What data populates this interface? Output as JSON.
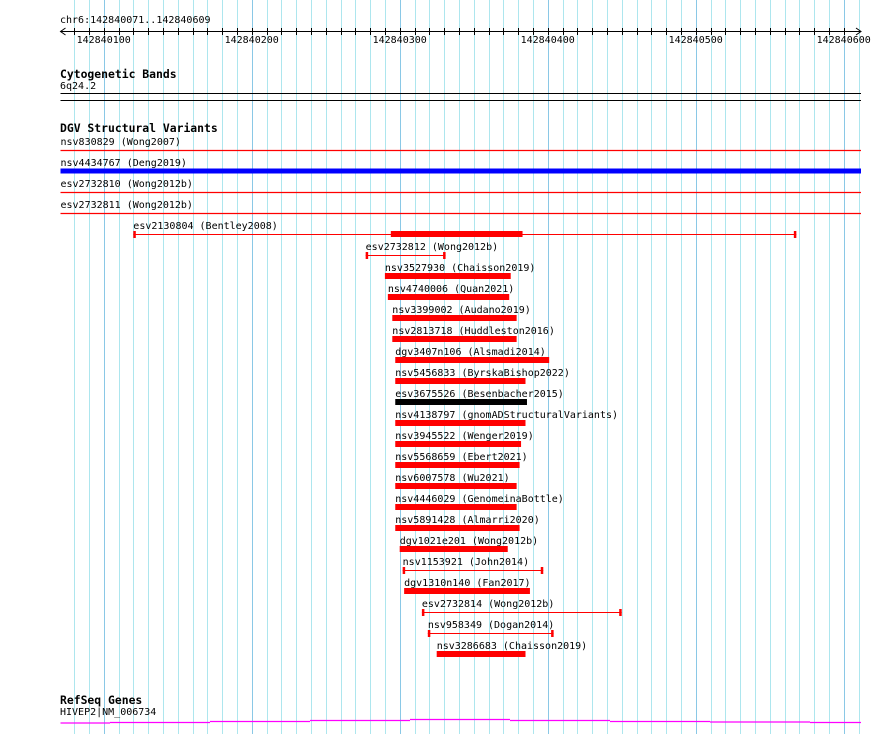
{
  "view": {
    "chrom": "chr6",
    "start": 142840071,
    "end": 142840609,
    "location_label": "chr6:142840071..142840609",
    "ruler_ticks": [
      "142840100",
      "142840200",
      "142840300",
      "142840400",
      "142840500",
      "142840600"
    ],
    "grid_major_bp": 100,
    "grid_minor_bp": 10
  },
  "colors": {
    "grid_minor": "#ade6ee",
    "grid_major": "#8ac8e6",
    "loss": "#ff0000",
    "gain": "#0000ff",
    "complex": "#000000",
    "gene": "#ff00ff"
  },
  "tracks": {
    "cytoband": {
      "title": "Cytogenetic Bands",
      "label": "6q24.2"
    },
    "dgv": {
      "title": "DGV Structural Variants",
      "features": [
        {
          "label": "nsv830829 (Wong2007)",
          "start": 142840000,
          "end": 142840700,
          "glyph": "line",
          "color": "#ff0000"
        },
        {
          "label": "nsv4434767 (Deng2019)",
          "start": 142840000,
          "end": 142840700,
          "glyph": "thickline",
          "color": "#0000ff"
        },
        {
          "label": "esv2732810 (Wong2012b)",
          "start": 142840000,
          "end": 142840700,
          "glyph": "line",
          "color": "#ff0000"
        },
        {
          "label": "esv2732811 (Wong2012b)",
          "start": 142840000,
          "end": 142840700,
          "glyph": "line",
          "color": "#ff0000"
        },
        {
          "label": "esv2130804 (Bentley2008)",
          "start": 142840120,
          "end": 142840568,
          "thick_start": 142840294,
          "thick_end": 142840383,
          "glyph": "capped",
          "color": "#ff0000"
        },
        {
          "label": "esv2732812 (Wong2012b)",
          "start": 142840277,
          "end": 142840331,
          "glyph": "capped",
          "color": "#ff0000"
        },
        {
          "label": "nsv3527930 (Chaisson2019)",
          "start": 142840290,
          "end": 142840375,
          "glyph": "bar",
          "color": "#ff0000"
        },
        {
          "label": "nsv4740006 (Quan2021)",
          "start": 142840292,
          "end": 142840374,
          "glyph": "bar",
          "color": "#ff0000"
        },
        {
          "label": "nsv3399002 (Audano2019)",
          "start": 142840295,
          "end": 142840379,
          "glyph": "bar",
          "color": "#ff0000"
        },
        {
          "label": "nsv2813718 (Huddleston2016)",
          "start": 142840295,
          "end": 142840379,
          "glyph": "bar",
          "color": "#ff0000"
        },
        {
          "label": "dgv3407n106 (Alsmadi2014)",
          "start": 142840297,
          "end": 142840401,
          "glyph": "bar",
          "color": "#ff0000"
        },
        {
          "label": "nsv5456833 (ByrskaBishop2022)",
          "start": 142840297,
          "end": 142840385,
          "glyph": "bar",
          "color": "#ff0000"
        },
        {
          "label": "esv3675526 (Besenbacher2015)",
          "start": 142840297,
          "end": 142840386,
          "glyph": "bar",
          "color": "#000000"
        },
        {
          "label": "nsv4138797 (gnomADStructuralVariants)",
          "start": 142840297,
          "end": 142840385,
          "glyph": "bar",
          "color": "#ff0000"
        },
        {
          "label": "nsv3945522 (Wenger2019)",
          "start": 142840297,
          "end": 142840382,
          "glyph": "bar",
          "color": "#ff0000"
        },
        {
          "label": "nsv5568659 (Ebert2021)",
          "start": 142840297,
          "end": 142840381,
          "glyph": "bar",
          "color": "#ff0000"
        },
        {
          "label": "nsv6007578 (Wu2021)",
          "start": 142840297,
          "end": 142840379,
          "glyph": "bar",
          "color": "#ff0000"
        },
        {
          "label": "nsv4446029 (GenomeinaBottle)",
          "start": 142840297,
          "end": 142840379,
          "glyph": "bar",
          "color": "#ff0000"
        },
        {
          "label": "nsv5891428 (Almarri2020)",
          "start": 142840297,
          "end": 142840381,
          "glyph": "bar",
          "color": "#ff0000"
        },
        {
          "label": "dgv1021e201 (Wong2012b)",
          "start": 142840300,
          "end": 142840373,
          "glyph": "bar",
          "color": "#ff0000"
        },
        {
          "label": "nsv1153921 (John2014)",
          "start": 142840302,
          "end": 142840397,
          "glyph": "capped",
          "color": "#ff0000"
        },
        {
          "label": "dgv1310n140 (Fan2017)",
          "start": 142840303,
          "end": 142840388,
          "glyph": "bar",
          "color": "#ff0000"
        },
        {
          "label": "esv2732814 (Wong2012b)",
          "start": 142840315,
          "end": 142840450,
          "glyph": "capped",
          "color": "#ff0000"
        },
        {
          "label": "nsv958349 (Dogan2014)",
          "start": 142840319,
          "end": 142840404,
          "glyph": "capped",
          "color": "#ff0000"
        },
        {
          "label": "nsv3286683 (Chaisson2019)",
          "start": 142840325,
          "end": 142840385,
          "glyph": "bar",
          "color": "#ff0000"
        }
      ]
    },
    "refseq": {
      "title": "RefSeq Genes",
      "label": "HIVEP2|NM_006734"
    }
  }
}
